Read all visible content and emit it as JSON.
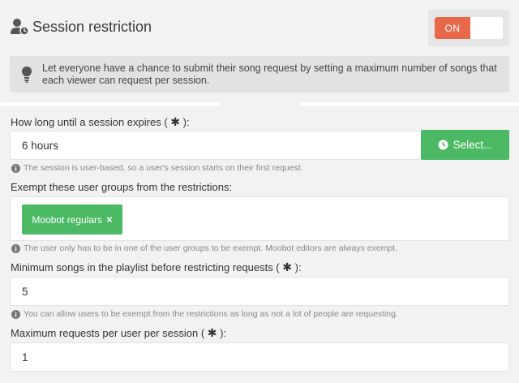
{
  "header": {
    "title": "Session restriction",
    "toggle_label": "ON",
    "info_text": "Let everyone have a chance to submit their song request by setting a maximum number of songs that each viewer can request per session."
  },
  "session_expiry": {
    "label_prefix": "How long until a session expires (",
    "label_suffix": "):",
    "asterisk": "✱",
    "value": "6 hours",
    "button_label": "Select...",
    "help": "The session is user-based, so a user's session starts on their first request."
  },
  "exempt_groups": {
    "label": "Exempt these user groups from the restrictions:",
    "tags": [
      {
        "label": "Moobot regulars",
        "remove": "×"
      }
    ],
    "help": "The user only has to be in one of the user groups to be exempt. Moobot editors are always exempt."
  },
  "min_songs": {
    "label_prefix": "Minimum songs in the playlist before restricting requests (",
    "label_suffix": "):",
    "asterisk": "✱",
    "value": "5",
    "help": "You can allow users to be exempt from the restrictions as long as not a lot of people are requesting."
  },
  "max_requests": {
    "label_prefix": "Maximum requests per user per session (",
    "label_suffix": "):",
    "asterisk": "✱",
    "value": "1"
  },
  "colors": {
    "toggle_on": "#e8684a",
    "accent_green": "#4cb964"
  }
}
